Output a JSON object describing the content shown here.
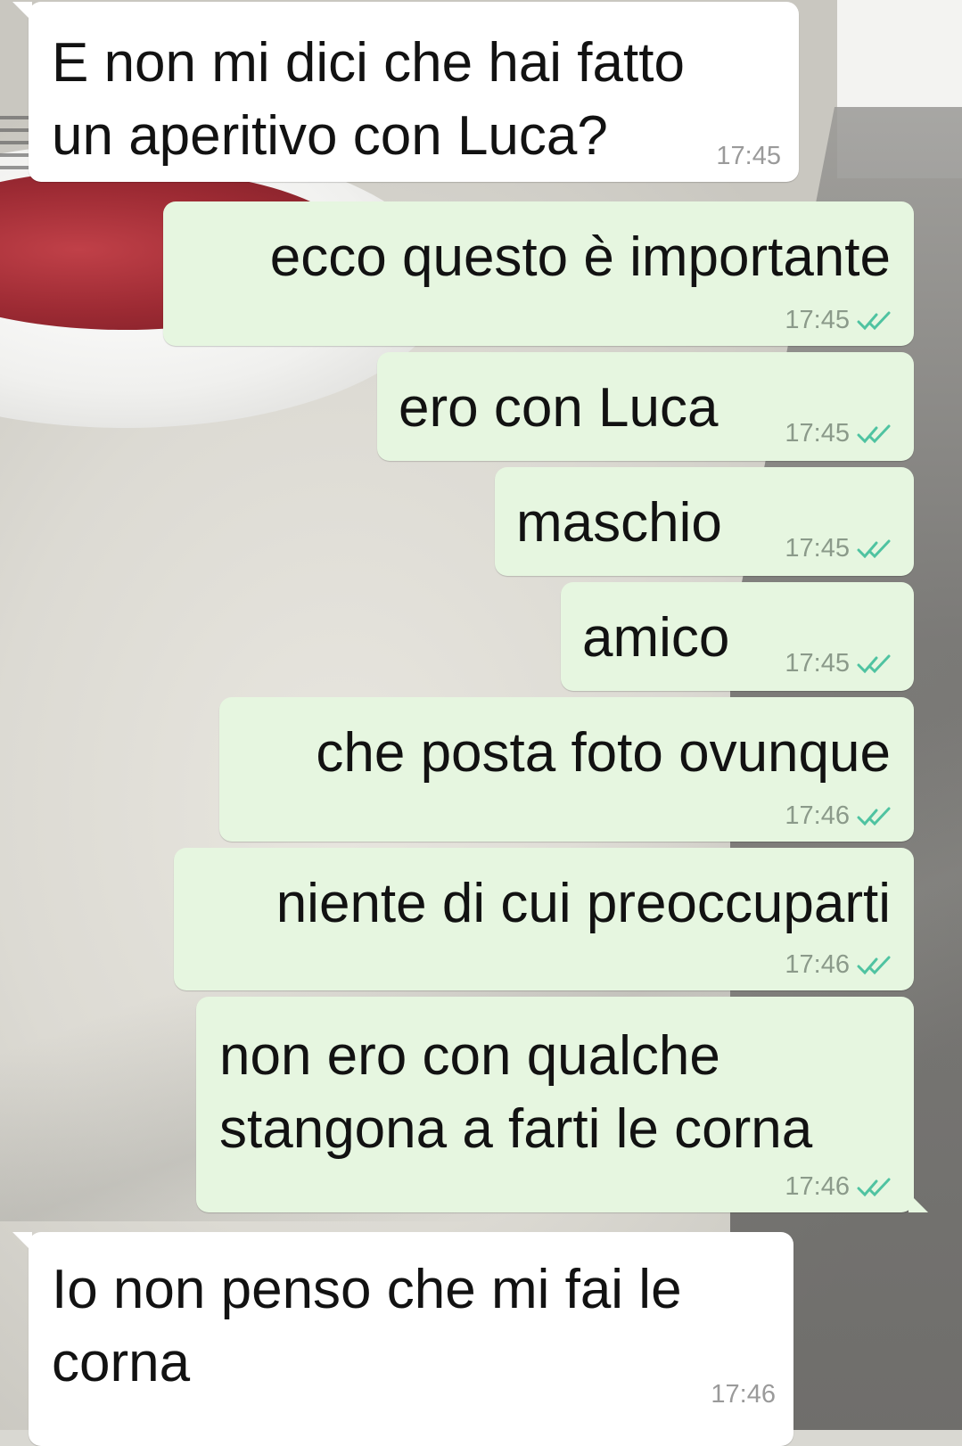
{
  "messages": [
    {
      "direction": "in",
      "text": "E non mi dici che hai fatto\nun aperitivo con Luca?",
      "time": "17:45"
    },
    {
      "direction": "out",
      "text": "ecco questo è importante",
      "time": "17:45",
      "status": "read"
    },
    {
      "direction": "out",
      "text": "ero con Luca",
      "time": "17:45",
      "status": "read"
    },
    {
      "direction": "out",
      "text": "maschio",
      "time": "17:45",
      "status": "read"
    },
    {
      "direction": "out",
      "text": "amico",
      "time": "17:45",
      "status": "read"
    },
    {
      "direction": "out",
      "text": "che posta foto ovunque",
      "time": "17:46",
      "status": "read"
    },
    {
      "direction": "out",
      "text": "niente di cui preoccuparti",
      "time": "17:46",
      "status": "read"
    },
    {
      "direction": "out",
      "text": "non ero con qualche\nstangona a farti le corna",
      "time": "17:46",
      "status": "read"
    },
    {
      "direction": "in",
      "text": "Io non penso che mi fai le\ncorna",
      "time": "17:46"
    }
  ],
  "colors": {
    "incoming_bubble": "#ffffff",
    "outgoing_bubble": "#e6f6e0",
    "read_ticks": "#4fc3a1",
    "timestamp": "#8b9a8a"
  },
  "icons": {
    "read_status": "double-check-icon"
  }
}
